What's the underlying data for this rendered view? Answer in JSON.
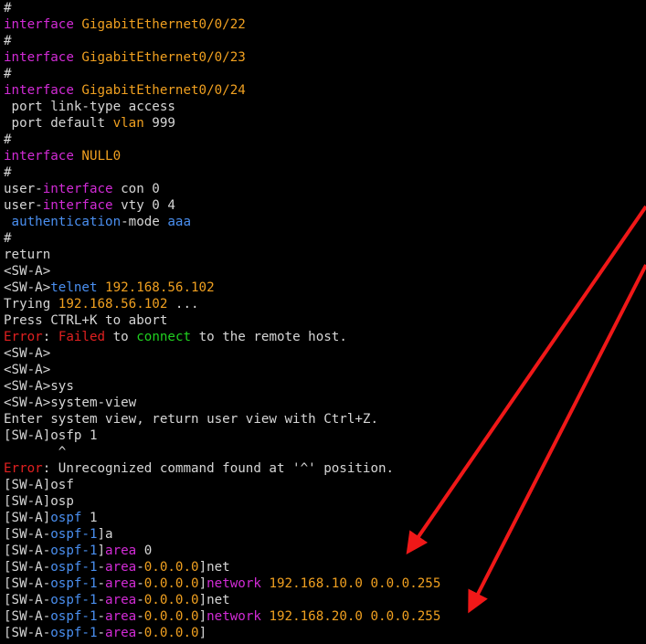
{
  "colors": {
    "default": "#d6d6d6",
    "keyword": "#d22bd6",
    "value": "#f0a020",
    "blue": "#4a8ff0",
    "red": "#e02020",
    "green": "#20d020",
    "arrow": "#f01818"
  },
  "terminal": {
    "lines": [
      {
        "segments": [
          {
            "text": "#",
            "color": "default"
          }
        ]
      },
      {
        "segments": [
          {
            "text": "interface ",
            "color": "keyword"
          },
          {
            "text": "GigabitEthernet0/0/22",
            "color": "value"
          }
        ]
      },
      {
        "segments": [
          {
            "text": "#",
            "color": "default"
          }
        ]
      },
      {
        "segments": [
          {
            "text": "interface ",
            "color": "keyword"
          },
          {
            "text": "GigabitEthernet0/0/23",
            "color": "value"
          }
        ]
      },
      {
        "segments": [
          {
            "text": "#",
            "color": "default"
          }
        ]
      },
      {
        "segments": [
          {
            "text": "interface ",
            "color": "keyword"
          },
          {
            "text": "GigabitEthernet0/0/24",
            "color": "value"
          }
        ]
      },
      {
        "segments": [
          {
            "text": " port link-type access",
            "color": "default"
          }
        ]
      },
      {
        "segments": [
          {
            "text": " port default ",
            "color": "default"
          },
          {
            "text": "vlan",
            "color": "value"
          },
          {
            "text": " 999",
            "color": "default"
          }
        ]
      },
      {
        "segments": [
          {
            "text": "#",
            "color": "default"
          }
        ]
      },
      {
        "segments": [
          {
            "text": "interface ",
            "color": "keyword"
          },
          {
            "text": "NULL0",
            "color": "value"
          }
        ]
      },
      {
        "segments": [
          {
            "text": "#",
            "color": "default"
          }
        ]
      },
      {
        "segments": [
          {
            "text": "user-",
            "color": "default"
          },
          {
            "text": "interface",
            "color": "keyword"
          },
          {
            "text": " con 0",
            "color": "default"
          }
        ]
      },
      {
        "segments": [
          {
            "text": "user-",
            "color": "default"
          },
          {
            "text": "interface",
            "color": "keyword"
          },
          {
            "text": " vty 0 4",
            "color": "default"
          }
        ]
      },
      {
        "segments": [
          {
            "text": " ",
            "color": "default"
          },
          {
            "text": "authentication",
            "color": "blue"
          },
          {
            "text": "-mode ",
            "color": "default"
          },
          {
            "text": "aaa",
            "color": "blue"
          }
        ]
      },
      {
        "segments": [
          {
            "text": "#",
            "color": "default"
          }
        ]
      },
      {
        "segments": [
          {
            "text": "return",
            "color": "default"
          }
        ]
      },
      {
        "segments": [
          {
            "text": "<SW-A>",
            "color": "default"
          }
        ]
      },
      {
        "segments": [
          {
            "text": "<SW-A>",
            "color": "default"
          },
          {
            "text": "telnet",
            "color": "blue"
          },
          {
            "text": " ",
            "color": "default"
          },
          {
            "text": "192.168.56.102",
            "color": "value"
          }
        ]
      },
      {
        "segments": [
          {
            "text": "Trying ",
            "color": "default"
          },
          {
            "text": "192.168.56.102",
            "color": "value"
          },
          {
            "text": " ...",
            "color": "default"
          }
        ]
      },
      {
        "segments": [
          {
            "text": "Press CTRL+K to abort",
            "color": "default"
          }
        ]
      },
      {
        "segments": [
          {
            "text": "Error",
            "color": "red"
          },
          {
            "text": ": ",
            "color": "default"
          },
          {
            "text": "Failed",
            "color": "red"
          },
          {
            "text": " to ",
            "color": "default"
          },
          {
            "text": "connect",
            "color": "green"
          },
          {
            "text": " to the remote host.",
            "color": "default"
          }
        ]
      },
      {
        "segments": [
          {
            "text": "<SW-A>",
            "color": "default"
          }
        ]
      },
      {
        "segments": [
          {
            "text": "<SW-A>",
            "color": "default"
          }
        ]
      },
      {
        "segments": [
          {
            "text": "<SW-A>sys",
            "color": "default"
          }
        ]
      },
      {
        "segments": [
          {
            "text": "<SW-A>system-view",
            "color": "default"
          }
        ]
      },
      {
        "segments": [
          {
            "text": "Enter system view, return user view with Ctrl+Z.",
            "color": "default"
          }
        ]
      },
      {
        "segments": [
          {
            "text": "[SW-A]osfp 1",
            "color": "default"
          }
        ]
      },
      {
        "segments": [
          {
            "text": "       ^",
            "color": "default"
          }
        ]
      },
      {
        "segments": [
          {
            "text": "Error",
            "color": "red"
          },
          {
            "text": ": Unrecognized command found at '^' position.",
            "color": "default"
          }
        ]
      },
      {
        "segments": [
          {
            "text": "[SW-A]osf",
            "color": "default"
          }
        ]
      },
      {
        "segments": [
          {
            "text": "[SW-A]osp",
            "color": "default"
          }
        ]
      },
      {
        "segments": [
          {
            "text": "[SW-A]",
            "color": "default"
          },
          {
            "text": "ospf",
            "color": "blue"
          },
          {
            "text": " 1",
            "color": "default"
          }
        ]
      },
      {
        "segments": [
          {
            "text": "[SW-A-",
            "color": "default"
          },
          {
            "text": "ospf-1",
            "color": "blue"
          },
          {
            "text": "]a",
            "color": "default"
          }
        ]
      },
      {
        "segments": [
          {
            "text": "[SW-A-",
            "color": "default"
          },
          {
            "text": "ospf-1",
            "color": "blue"
          },
          {
            "text": "]",
            "color": "default"
          },
          {
            "text": "area",
            "color": "keyword"
          },
          {
            "text": " 0",
            "color": "default"
          }
        ]
      },
      {
        "segments": [
          {
            "text": "[SW-A-",
            "color": "default"
          },
          {
            "text": "ospf-1",
            "color": "blue"
          },
          {
            "text": "-",
            "color": "default"
          },
          {
            "text": "area",
            "color": "keyword"
          },
          {
            "text": "-",
            "color": "default"
          },
          {
            "text": "0.0.0.0",
            "color": "value"
          },
          {
            "text": "]net",
            "color": "default"
          }
        ]
      },
      {
        "segments": [
          {
            "text": "[SW-A-",
            "color": "default"
          },
          {
            "text": "ospf-1",
            "color": "blue"
          },
          {
            "text": "-",
            "color": "default"
          },
          {
            "text": "area",
            "color": "keyword"
          },
          {
            "text": "-",
            "color": "default"
          },
          {
            "text": "0.0.0.0",
            "color": "value"
          },
          {
            "text": "]",
            "color": "default"
          },
          {
            "text": "network",
            "color": "keyword"
          },
          {
            "text": " ",
            "color": "default"
          },
          {
            "text": "192.168.10.0",
            "color": "value"
          },
          {
            "text": " ",
            "color": "default"
          },
          {
            "text": "0.0.0.255",
            "color": "value"
          }
        ]
      },
      {
        "segments": [
          {
            "text": "[SW-A-",
            "color": "default"
          },
          {
            "text": "ospf-1",
            "color": "blue"
          },
          {
            "text": "-",
            "color": "default"
          },
          {
            "text": "area",
            "color": "keyword"
          },
          {
            "text": "-",
            "color": "default"
          },
          {
            "text": "0.0.0.0",
            "color": "value"
          },
          {
            "text": "]net",
            "color": "default"
          }
        ]
      },
      {
        "segments": [
          {
            "text": "[SW-A-",
            "color": "default"
          },
          {
            "text": "ospf-1",
            "color": "blue"
          },
          {
            "text": "-",
            "color": "default"
          },
          {
            "text": "area",
            "color": "keyword"
          },
          {
            "text": "-",
            "color": "default"
          },
          {
            "text": "0.0.0.0",
            "color": "value"
          },
          {
            "text": "]",
            "color": "default"
          },
          {
            "text": "network",
            "color": "keyword"
          },
          {
            "text": " ",
            "color": "default"
          },
          {
            "text": "192.168.20.0",
            "color": "value"
          },
          {
            "text": " ",
            "color": "default"
          },
          {
            "text": "0.0.0.255",
            "color": "value"
          }
        ]
      },
      {
        "segments": [
          {
            "text": "[SW-A-",
            "color": "default"
          },
          {
            "text": "ospf-1",
            "color": "blue"
          },
          {
            "text": "-",
            "color": "default"
          },
          {
            "text": "area",
            "color": "keyword"
          },
          {
            "text": "-",
            "color": "default"
          },
          {
            "text": "0.0.0.0",
            "color": "value"
          },
          {
            "text": "]",
            "color": "default"
          }
        ]
      }
    ]
  },
  "annotations": {
    "arrows": [
      {
        "name": "annotation-arrow-network-10",
        "color": "arrow"
      },
      {
        "name": "annotation-arrow-network-20",
        "color": "arrow"
      }
    ]
  }
}
